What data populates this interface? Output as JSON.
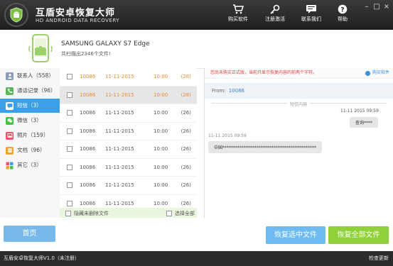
{
  "header": {
    "title": "互盾安卓恢复大师",
    "subtitle": "HD ANDROID DATA RECOVERY",
    "toolbar": [
      {
        "label": "购买软件",
        "icon": "cart-icon"
      },
      {
        "label": "注册激活",
        "icon": "key-icon"
      },
      {
        "label": "联系我们",
        "icon": "chat-icon"
      },
      {
        "label": "帮助",
        "icon": "help-icon"
      }
    ],
    "window_controls": {
      "minimize": "–",
      "maximize": "□",
      "close": "×"
    }
  },
  "device": {
    "name": "SAMSUNG GALAXY S7 Edge",
    "scan_result": "共扫描出2346个文件!"
  },
  "sidebar": {
    "items": [
      {
        "label": "联系人（558）",
        "icon": "contacts-icon",
        "color": "#8a9bb5",
        "active": false
      },
      {
        "label": "通话记录（96）",
        "icon": "call-log-icon",
        "color": "#5cb85c",
        "active": false
      },
      {
        "label": "短信（3）",
        "icon": "sms-icon",
        "color": "#3aa0e8",
        "active": true
      },
      {
        "label": "微信（3）",
        "icon": "wechat-icon",
        "color": "#45c247",
        "active": false
      },
      {
        "label": "照片（159）",
        "icon": "photo-icon",
        "color": "#e8556b",
        "active": false
      },
      {
        "label": "文档（96）",
        "icon": "document-icon",
        "color": "#f0a430",
        "active": false
      },
      {
        "label": "其它（3）",
        "icon": "other-icon",
        "color": "#7a7ae0",
        "active": false
      }
    ]
  },
  "messages": {
    "rows": [
      {
        "number": "10086",
        "date": "11-11-2015",
        "time": "10:00",
        "count": "(26)",
        "highlight": true,
        "selected": false
      },
      {
        "number": "10086",
        "date": "11-11-2015",
        "time": "10:00",
        "count": "(26)",
        "highlight": true,
        "selected": true
      },
      {
        "number": "10086",
        "date": "11-11-2015",
        "time": "10:00",
        "count": "(26)",
        "highlight": false,
        "selected": false
      },
      {
        "number": "10086",
        "date": "11-11-2015",
        "time": "10:00",
        "count": "(26)",
        "highlight": false,
        "selected": false
      },
      {
        "number": "10086",
        "date": "11-11-2015",
        "time": "10:00",
        "count": "(26)",
        "highlight": false,
        "selected": false
      },
      {
        "number": "10086",
        "date": "11-11-2015",
        "time": "10:00",
        "count": "(26)",
        "highlight": false,
        "selected": false
      },
      {
        "number": "10086",
        "date": "11-11-2015",
        "time": "10:00",
        "count": "(26)",
        "highlight": false,
        "selected": false
      },
      {
        "number": "10086",
        "date": "11-11-2015",
        "time": "10:00",
        "count": "(26)",
        "highlight": false,
        "selected": false
      }
    ],
    "hide_deleted_label": "隐藏未删除文件",
    "select_all_label": "选择全部"
  },
  "detail": {
    "notice": "您尚未购买正式版，当前只显示恢复内容的前两个字符。",
    "buy_link": "购买软件",
    "from_label": "From:",
    "from_value": "10086",
    "section_label": "短信内容",
    "sent_time": "11-11  2015  09:59",
    "sent_text": "查询****",
    "received_time": "11-11  2015  09:59",
    "received_text": "中国********************************************"
  },
  "bottom": {
    "home_label": "首页",
    "recover_selected_label": "恢复选中文件",
    "recover_all_label": "恢复全部文件"
  },
  "status_bar": {
    "version": "互盾安卓恢复大师V1.0（未注册）",
    "check_update": "检查更新"
  },
  "colors": {
    "accent_blue": "#3aa0e8",
    "accent_green": "#8fd13b",
    "highlight_orange": "#e98b2c",
    "notice_red": "#e23c3c"
  }
}
